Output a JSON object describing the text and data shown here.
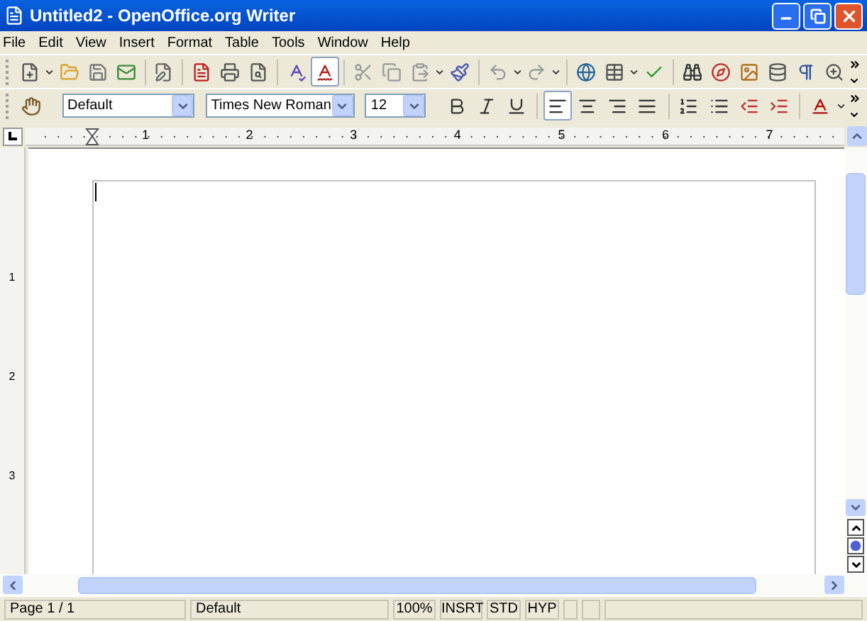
{
  "window": {
    "title": "Untitled2 - OpenOffice.org Writer"
  },
  "menu": [
    "File",
    "Edit",
    "View",
    "Insert",
    "Format",
    "Table",
    "Tools",
    "Window",
    "Help"
  ],
  "standard_toolbar": {
    "autospellcheck_on": true
  },
  "formatting_toolbar": {
    "paragraph_style": "Default",
    "font_name": "Times New Roman",
    "font_size": "12",
    "alignment": [
      {
        "selected": true
      },
      {
        "selected": false
      },
      {
        "selected": false
      },
      {
        "selected": false
      }
    ]
  },
  "ruler": {
    "marks": [
      "1",
      "2",
      "3",
      "4",
      "5",
      "6",
      "7"
    ]
  },
  "vertical_ruler": {
    "marks": [
      "1",
      "2",
      "3"
    ]
  },
  "status_bar": [
    "Page 1 / 1",
    "Default",
    "100%",
    "INSRT",
    "STD",
    "HYP"
  ]
}
